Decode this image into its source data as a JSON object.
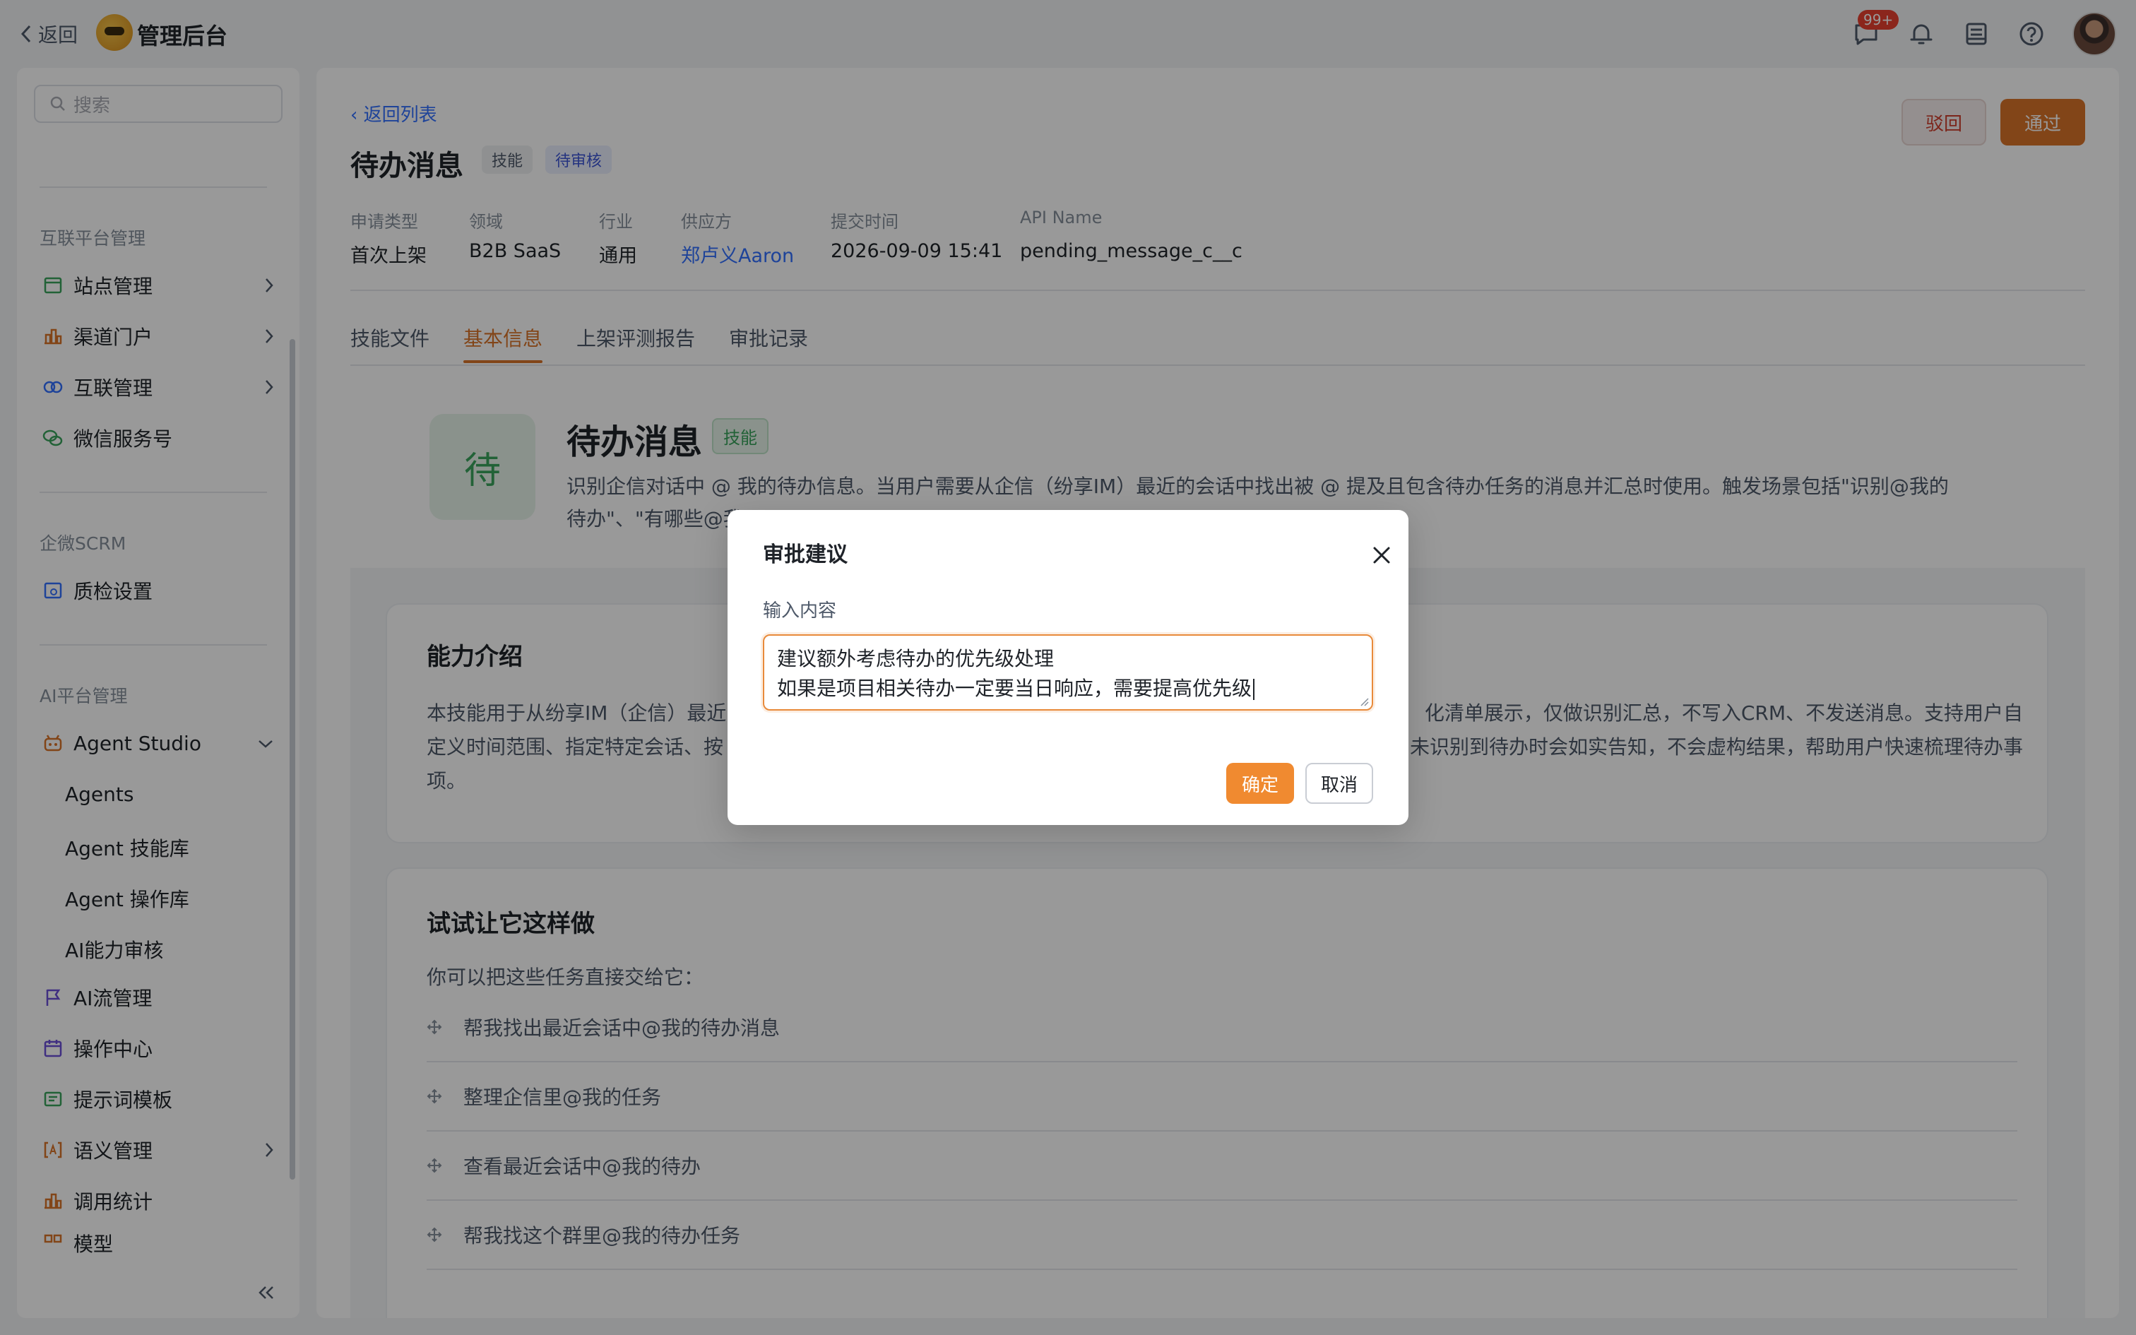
{
  "topbar": {
    "back_label": "返回",
    "app_title": "管理后台",
    "message_badge": "99+"
  },
  "sidebar": {
    "search_placeholder": "搜索",
    "groups": [
      {
        "title": "互联平台管理",
        "items": [
          {
            "label": "站点管理",
            "icon": "site-icon"
          },
          {
            "label": "渠道门户",
            "icon": "channel-icon"
          },
          {
            "label": "互联管理",
            "icon": "link-icon"
          },
          {
            "label": "微信服务号",
            "icon": "wechat-icon"
          }
        ]
      },
      {
        "title": "企微SCRM",
        "items": [
          {
            "label": "质检设置",
            "icon": "quality-icon"
          }
        ]
      },
      {
        "title": "AI平台管理",
        "items": [
          {
            "label": "Agent Studio",
            "icon": "robot-icon"
          },
          {
            "label": "Agents"
          },
          {
            "label": "Agent 技能库"
          },
          {
            "label": "Agent 操作库"
          },
          {
            "label": "AI能力审核"
          },
          {
            "label": "AI流管理",
            "icon": "flag-icon"
          },
          {
            "label": "操作中心",
            "icon": "calendar-icon"
          },
          {
            "label": "提示词模板",
            "icon": "template-icon"
          },
          {
            "label": "语义管理",
            "icon": "semantic-icon"
          },
          {
            "label": "调用统计",
            "icon": "stats-icon"
          },
          {
            "label": "模型",
            "icon": "model-icon"
          }
        ]
      }
    ]
  },
  "detail": {
    "back_list": "返回列表",
    "title": "待办消息",
    "tag_skill": "技能",
    "tag_status": "待审核",
    "reject_label": "驳回",
    "pass_label": "通过",
    "meta": [
      {
        "label": "申请类型",
        "value": "首次上架"
      },
      {
        "label": "领域",
        "value": "B2B SaaS"
      },
      {
        "label": "行业",
        "value": "通用"
      },
      {
        "label": "供应方",
        "value": "郑卢义Aaron"
      },
      {
        "label": "提交时间",
        "value": "2026-09-09 15:41"
      },
      {
        "label": "API Name",
        "value": "pending_message_c__c"
      }
    ],
    "tabs": [
      "技能文件",
      "基本信息",
      "上架评测报告",
      "审批记录"
    ],
    "active_tab": "基本信息",
    "skill": {
      "icon_char": "待",
      "name": "待办消息",
      "tag": "技能",
      "desc_line1": "识别企信对话中 @ 我的待办信息。当用户需要从企信（纷享IM）最近的会话中找出被 @ 提及且包含待办任务的消息并汇总时使用。触发场景包括\"识别@我的",
      "desc_line2": "待办\"、\"有哪些@我"
    },
    "ability": {
      "title": "能力介绍",
      "line1_left": "本技能用于从纷享IM（企信）最近",
      "line1_right": "化清单展示，仅做识别汇总，不写入CRM、不发送消息。支持用户自",
      "line2_left": "定义时间范围、指定特定会话、按",
      "line2_right": "未识别到待办时会如实告知，不会虚构结果，帮助用户快速梳理待办事",
      "line3": "项。"
    },
    "try": {
      "title": "试试让它这样做",
      "intro": "你可以把这些任务直接交给它：",
      "items": [
        "帮我找出最近会话中@我的待办消息",
        "整理企信里@我的任务",
        "查看最近会话中@我的待办",
        "帮我找这个群里@我的待办任务"
      ]
    }
  },
  "modal": {
    "title": "审批建议",
    "input_label": "输入内容",
    "textarea_line1": "建议额外考虑待办的优先级处理",
    "textarea_line2": "如果是项目相关待办一定要当日响应，需要提高优先级",
    "ok_label": "确定",
    "cancel_label": "取消"
  },
  "colors": {
    "accent": "#d97328",
    "link": "#3370ff",
    "skill_green": "#3aa35c",
    "reject_red": "#cf3f2d"
  }
}
